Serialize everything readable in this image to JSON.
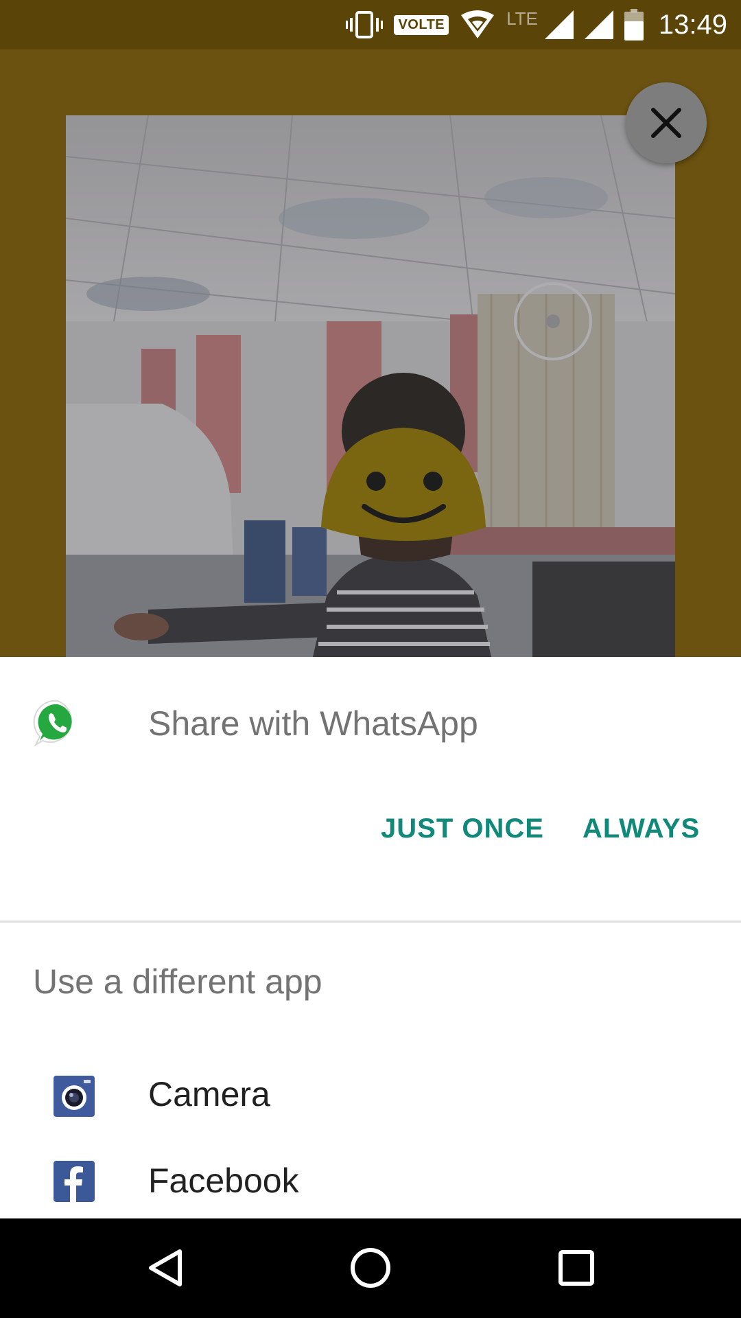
{
  "status_bar": {
    "volte": "VOLTE",
    "lte": "LTE",
    "time": "13:49",
    "icons": [
      "vibrate-icon",
      "volte-icon",
      "wifi-icon",
      "signal-icon",
      "signal-icon",
      "battery-icon"
    ]
  },
  "preview": {
    "close_icon": "close-icon",
    "image": "shared-photo"
  },
  "share_sheet": {
    "primary_app": {
      "icon": "whatsapp-icon",
      "title": "Share with WhatsApp"
    },
    "actions": {
      "just_once": "JUST ONCE",
      "always": "ALWAYS"
    },
    "different_app_label": "Use a different app",
    "apps": [
      {
        "icon": "camera-icon",
        "label": "Camera"
      },
      {
        "icon": "facebook-icon",
        "label": "Facebook"
      }
    ]
  },
  "nav_bar": {
    "icons": [
      "back-icon",
      "home-icon",
      "recents-icon"
    ]
  },
  "colors": {
    "accent": "#10897a",
    "status_bar": "#5a4408",
    "backdrop": "#6b5210",
    "sheet": "#ffffff"
  }
}
